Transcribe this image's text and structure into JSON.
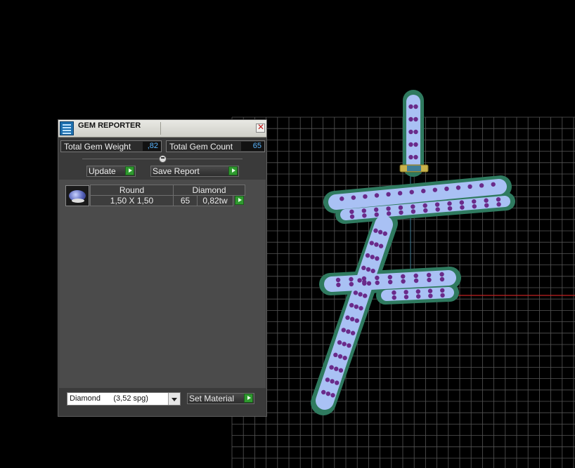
{
  "panel": {
    "title": "GEM REPORTER",
    "close_glyph": "✕",
    "total_gem_weight_label": "Total Gem Weight",
    "total_gem_weight_value": ",82",
    "total_gem_count_label": "Total Gem Count",
    "total_gem_count_value": "65",
    "update_label": "Update",
    "save_report_label": "Save Report",
    "gems": [
      {
        "cut": "Round",
        "material": "Diamond",
        "size": "1,50 X 1,50",
        "count": "65",
        "weight": "0,82tw"
      }
    ],
    "material_select": "Diamond      (3,52 spg)",
    "set_material_label": "Set Material"
  },
  "colors": {
    "grid": "#555555",
    "x_axis": "#c42222",
    "y_axis": "#3f7d96",
    "metal": "#2f7a5f",
    "gem_body": "#a9c1f4",
    "gem_dot": "#6a2a8a",
    "accent_play": "#2f9a2f"
  },
  "icons": [
    "gem-reporter-icon",
    "close-icon",
    "collapse-knob-icon",
    "play-icon",
    "round-diamond-icon",
    "dropdown-arrow-icon"
  ]
}
